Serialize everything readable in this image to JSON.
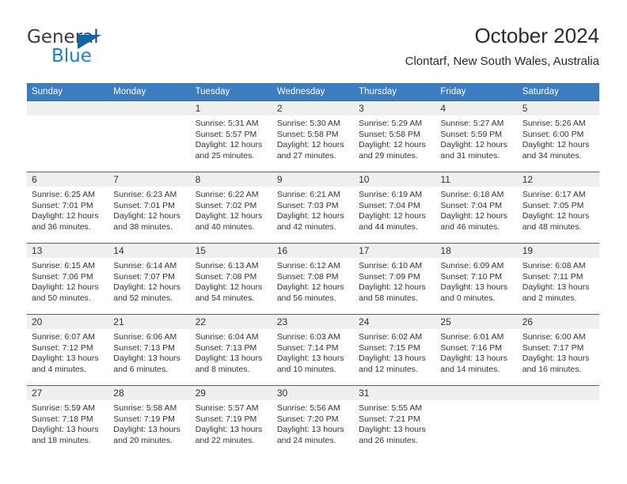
{
  "logo": {
    "word_one": "General",
    "word_two": "Blue",
    "triangle_icon": "blue-triangle-icon",
    "accent_color": "#1f7ec4",
    "triangle_color": "#1464a5"
  },
  "header": {
    "title": "October 2024",
    "subtitle": "Clontarf, New South Wales, Australia"
  },
  "theme": {
    "header_row_bg": "#3b7dbf",
    "row_divider": "#2e6da4",
    "daynum_band_bg": "#efefef",
    "text_color": "#333333"
  },
  "calendar": {
    "weekday_headers": [
      "Sunday",
      "Monday",
      "Tuesday",
      "Wednesday",
      "Thursday",
      "Friday",
      "Saturday"
    ],
    "labels": {
      "sunrise": "Sunrise:",
      "sunset": "Sunset:",
      "daylight": "Daylight:"
    },
    "weeks": [
      [
        {
          "day": "",
          "sunrise": "",
          "sunset": "",
          "daylight_line1": "",
          "daylight_line2": ""
        },
        {
          "day": "",
          "sunrise": "",
          "sunset": "",
          "daylight_line1": "",
          "daylight_line2": ""
        },
        {
          "day": "1",
          "sunrise": "Sunrise: 5:31 AM",
          "sunset": "Sunset: 5:57 PM",
          "daylight_line1": "Daylight: 12 hours",
          "daylight_line2": "and 25 minutes."
        },
        {
          "day": "2",
          "sunrise": "Sunrise: 5:30 AM",
          "sunset": "Sunset: 5:58 PM",
          "daylight_line1": "Daylight: 12 hours",
          "daylight_line2": "and 27 minutes."
        },
        {
          "day": "3",
          "sunrise": "Sunrise: 5:29 AM",
          "sunset": "Sunset: 5:58 PM",
          "daylight_line1": "Daylight: 12 hours",
          "daylight_line2": "and 29 minutes."
        },
        {
          "day": "4",
          "sunrise": "Sunrise: 5:27 AM",
          "sunset": "Sunset: 5:59 PM",
          "daylight_line1": "Daylight: 12 hours",
          "daylight_line2": "and 31 minutes."
        },
        {
          "day": "5",
          "sunrise": "Sunrise: 5:26 AM",
          "sunset": "Sunset: 6:00 PM",
          "daylight_line1": "Daylight: 12 hours",
          "daylight_line2": "and 34 minutes."
        }
      ],
      [
        {
          "day": "6",
          "sunrise": "Sunrise: 6:25 AM",
          "sunset": "Sunset: 7:01 PM",
          "daylight_line1": "Daylight: 12 hours",
          "daylight_line2": "and 36 minutes."
        },
        {
          "day": "7",
          "sunrise": "Sunrise: 6:23 AM",
          "sunset": "Sunset: 7:01 PM",
          "daylight_line1": "Daylight: 12 hours",
          "daylight_line2": "and 38 minutes."
        },
        {
          "day": "8",
          "sunrise": "Sunrise: 6:22 AM",
          "sunset": "Sunset: 7:02 PM",
          "daylight_line1": "Daylight: 12 hours",
          "daylight_line2": "and 40 minutes."
        },
        {
          "day": "9",
          "sunrise": "Sunrise: 6:21 AM",
          "sunset": "Sunset: 7:03 PM",
          "daylight_line1": "Daylight: 12 hours",
          "daylight_line2": "and 42 minutes."
        },
        {
          "day": "10",
          "sunrise": "Sunrise: 6:19 AM",
          "sunset": "Sunset: 7:04 PM",
          "daylight_line1": "Daylight: 12 hours",
          "daylight_line2": "and 44 minutes."
        },
        {
          "day": "11",
          "sunrise": "Sunrise: 6:18 AM",
          "sunset": "Sunset: 7:04 PM",
          "daylight_line1": "Daylight: 12 hours",
          "daylight_line2": "and 46 minutes."
        },
        {
          "day": "12",
          "sunrise": "Sunrise: 6:17 AM",
          "sunset": "Sunset: 7:05 PM",
          "daylight_line1": "Daylight: 12 hours",
          "daylight_line2": "and 48 minutes."
        }
      ],
      [
        {
          "day": "13",
          "sunrise": "Sunrise: 6:15 AM",
          "sunset": "Sunset: 7:06 PM",
          "daylight_line1": "Daylight: 12 hours",
          "daylight_line2": "and 50 minutes."
        },
        {
          "day": "14",
          "sunrise": "Sunrise: 6:14 AM",
          "sunset": "Sunset: 7:07 PM",
          "daylight_line1": "Daylight: 12 hours",
          "daylight_line2": "and 52 minutes."
        },
        {
          "day": "15",
          "sunrise": "Sunrise: 6:13 AM",
          "sunset": "Sunset: 7:08 PM",
          "daylight_line1": "Daylight: 12 hours",
          "daylight_line2": "and 54 minutes."
        },
        {
          "day": "16",
          "sunrise": "Sunrise: 6:12 AM",
          "sunset": "Sunset: 7:08 PM",
          "daylight_line1": "Daylight: 12 hours",
          "daylight_line2": "and 56 minutes."
        },
        {
          "day": "17",
          "sunrise": "Sunrise: 6:10 AM",
          "sunset": "Sunset: 7:09 PM",
          "daylight_line1": "Daylight: 12 hours",
          "daylight_line2": "and 58 minutes."
        },
        {
          "day": "18",
          "sunrise": "Sunrise: 6:09 AM",
          "sunset": "Sunset: 7:10 PM",
          "daylight_line1": "Daylight: 13 hours",
          "daylight_line2": "and 0 minutes."
        },
        {
          "day": "19",
          "sunrise": "Sunrise: 6:08 AM",
          "sunset": "Sunset: 7:11 PM",
          "daylight_line1": "Daylight: 13 hours",
          "daylight_line2": "and 2 minutes."
        }
      ],
      [
        {
          "day": "20",
          "sunrise": "Sunrise: 6:07 AM",
          "sunset": "Sunset: 7:12 PM",
          "daylight_line1": "Daylight: 13 hours",
          "daylight_line2": "and 4 minutes."
        },
        {
          "day": "21",
          "sunrise": "Sunrise: 6:06 AM",
          "sunset": "Sunset: 7:13 PM",
          "daylight_line1": "Daylight: 13 hours",
          "daylight_line2": "and 6 minutes."
        },
        {
          "day": "22",
          "sunrise": "Sunrise: 6:04 AM",
          "sunset": "Sunset: 7:13 PM",
          "daylight_line1": "Daylight: 13 hours",
          "daylight_line2": "and 8 minutes."
        },
        {
          "day": "23",
          "sunrise": "Sunrise: 6:03 AM",
          "sunset": "Sunset: 7:14 PM",
          "daylight_line1": "Daylight: 13 hours",
          "daylight_line2": "and 10 minutes."
        },
        {
          "day": "24",
          "sunrise": "Sunrise: 6:02 AM",
          "sunset": "Sunset: 7:15 PM",
          "daylight_line1": "Daylight: 13 hours",
          "daylight_line2": "and 12 minutes."
        },
        {
          "day": "25",
          "sunrise": "Sunrise: 6:01 AM",
          "sunset": "Sunset: 7:16 PM",
          "daylight_line1": "Daylight: 13 hours",
          "daylight_line2": "and 14 minutes."
        },
        {
          "day": "26",
          "sunrise": "Sunrise: 6:00 AM",
          "sunset": "Sunset: 7:17 PM",
          "daylight_line1": "Daylight: 13 hours",
          "daylight_line2": "and 16 minutes."
        }
      ],
      [
        {
          "day": "27",
          "sunrise": "Sunrise: 5:59 AM",
          "sunset": "Sunset: 7:18 PM",
          "daylight_line1": "Daylight: 13 hours",
          "daylight_line2": "and 18 minutes."
        },
        {
          "day": "28",
          "sunrise": "Sunrise: 5:58 AM",
          "sunset": "Sunset: 7:19 PM",
          "daylight_line1": "Daylight: 13 hours",
          "daylight_line2": "and 20 minutes."
        },
        {
          "day": "29",
          "sunrise": "Sunrise: 5:57 AM",
          "sunset": "Sunset: 7:19 PM",
          "daylight_line1": "Daylight: 13 hours",
          "daylight_line2": "and 22 minutes."
        },
        {
          "day": "30",
          "sunrise": "Sunrise: 5:56 AM",
          "sunset": "Sunset: 7:20 PM",
          "daylight_line1": "Daylight: 13 hours",
          "daylight_line2": "and 24 minutes."
        },
        {
          "day": "31",
          "sunrise": "Sunrise: 5:55 AM",
          "sunset": "Sunset: 7:21 PM",
          "daylight_line1": "Daylight: 13 hours",
          "daylight_line2": "and 26 minutes."
        },
        {
          "day": "",
          "sunrise": "",
          "sunset": "",
          "daylight_line1": "",
          "daylight_line2": ""
        },
        {
          "day": "",
          "sunrise": "",
          "sunset": "",
          "daylight_line1": "",
          "daylight_line2": ""
        }
      ]
    ]
  }
}
